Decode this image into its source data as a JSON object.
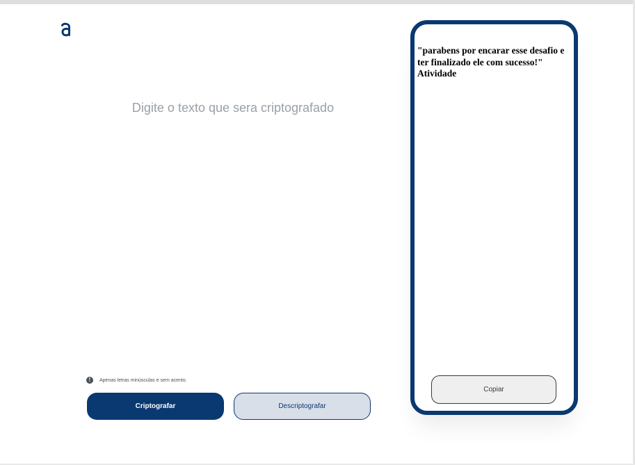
{
  "logo": {
    "icon": "alura-logo-icon",
    "color": "#0a3871"
  },
  "input": {
    "placeholder": "Digite o texto que sera criptografado",
    "value": ""
  },
  "notice": {
    "icon": "info-icon",
    "icon_glyph": "!",
    "text": "Apenas letras minúsculas e sem acento."
  },
  "buttons": {
    "encrypt_label": "Criptografar",
    "decrypt_label": "Descriptografar"
  },
  "output": {
    "text": "\"parabens por encarar esse desafio e ter finalizado ele com sucesso!\" Atividade",
    "copy_label": "Copiar"
  },
  "colors": {
    "primary": "#0a3871",
    "secondary_bg": "#d8dfe8",
    "placeholder": "#9aa0a6"
  }
}
